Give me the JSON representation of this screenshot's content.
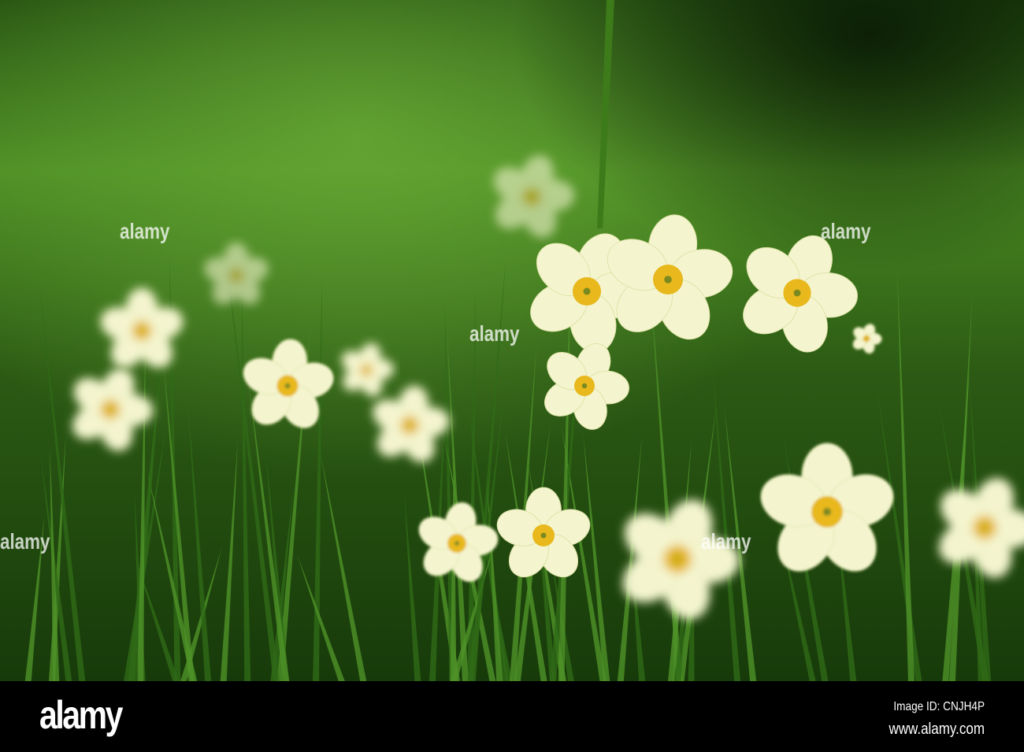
{
  "photo": {
    "subject": "primroses",
    "colors": {
      "petal": "#f4f5cf",
      "center": "#e8b81c",
      "grass": "#3f7a1c",
      "dark": "#0f2a08"
    }
  },
  "watermark": {
    "text": "alamy"
  },
  "footer": {
    "logo": "alamy",
    "image_id": "Image ID: CNJH4P",
    "website": "www.alamy.com"
  }
}
